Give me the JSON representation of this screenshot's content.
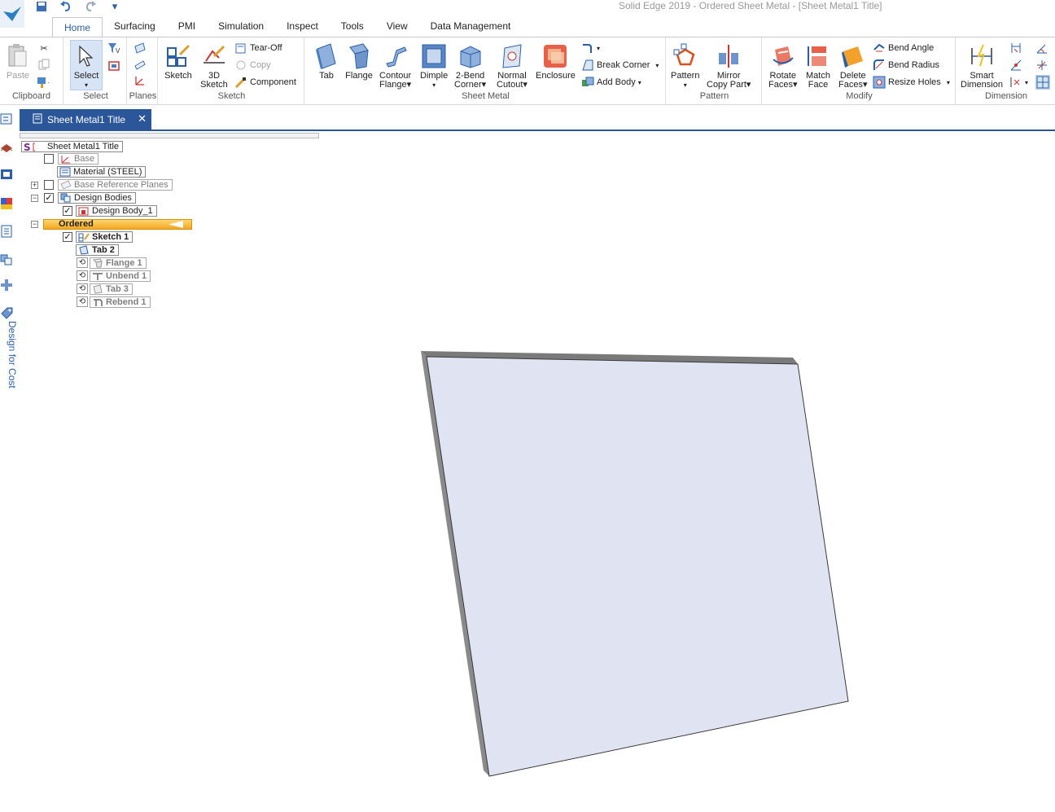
{
  "window": {
    "title": "Solid Edge 2019 - Ordered Sheet Metal - [Sheet Metal1 Title]"
  },
  "quick_access": [
    {
      "name": "save-icon",
      "glyph": "💾"
    },
    {
      "name": "undo-icon",
      "glyph": "↶"
    },
    {
      "name": "redo-icon",
      "glyph": "↷"
    },
    {
      "name": "customize-icon",
      "glyph": "▾"
    }
  ],
  "ribbon_tabs": [
    "Home",
    "Surfacing",
    "PMI",
    "Simulation",
    "Inspect",
    "Tools",
    "View",
    "Data Management"
  ],
  "ribbon": {
    "clipboard": {
      "label": "Clipboard",
      "paste": "Paste"
    },
    "select": {
      "label": "Select",
      "select": "Select"
    },
    "planes": {
      "label": "Planes"
    },
    "sketch": {
      "label": "Sketch",
      "sketch": "Sketch",
      "sketch3d_1": "3D",
      "sketch3d_2": "Sketch",
      "tear_off": "Tear-Off",
      "copy": "Copy",
      "component": "Component"
    },
    "sheet_metal": {
      "label": "Sheet Metal",
      "tab": "Tab",
      "flange": "Flange",
      "contour_1": "Contour",
      "contour_2": "Flange",
      "dimple": "Dimple",
      "twobend_1": "2-Bend",
      "twobend_2": "Corner",
      "normal_1": "Normal",
      "normal_2": "Cutout",
      "enclosure": "Enclosure",
      "break_corner": "Break Corner",
      "add_body": "Add Body"
    },
    "pattern": {
      "label": "Pattern",
      "pattern": "Pattern",
      "mirror_1": "Mirror",
      "mirror_2": "Copy Part"
    },
    "modify": {
      "label": "Modify",
      "rotate_1": "Rotate",
      "rotate_2": "Faces",
      "match_1": "Match",
      "match_2": "Face",
      "delete_1": "Delete",
      "delete_2": "Faces",
      "bend_angle": "Bend Angle",
      "bend_radius": "Bend Radius",
      "resize_holes": "Resize Holes"
    },
    "dimension": {
      "label": "Dimension",
      "smart_1": "Smart",
      "smart_2": "Dimension"
    }
  },
  "left_toolbar": {
    "design_for_cost": "Design for Cost"
  },
  "document_tab": {
    "title": "Sheet Metal1 Title"
  },
  "tree": {
    "root": "Sheet Metal1 Title",
    "base": "Base",
    "material": "Material (STEEL)",
    "base_ref_planes": "Base Reference Planes",
    "design_bodies": "Design Bodies",
    "design_body_1": "Design Body_1",
    "ordered": "Ordered",
    "sketch_1": "Sketch 1",
    "tab_2": "Tab 2",
    "flange_1": "Flange 1",
    "unbend_1": "Unbend 1",
    "tab_3": "Tab 3",
    "rebend_1": "Rebend 1"
  },
  "colors": {
    "accent": "#2b579a",
    "ordered": "#f4a820",
    "face": "#dfe3f2",
    "edge": "#7a7a7a"
  }
}
